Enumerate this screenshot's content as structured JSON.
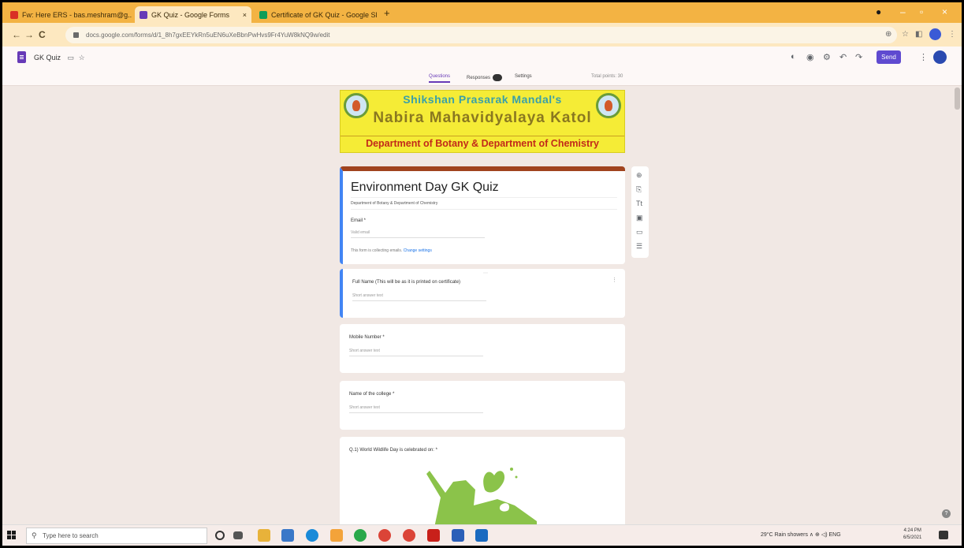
{
  "browser": {
    "tabs": [
      {
        "label": "Fw: Here ERS - bas.meshram@g...",
        "active": false,
        "favicon_color": "#d93025"
      },
      {
        "label": "GK Quiz - Google Forms",
        "active": true,
        "favicon_color": "#673ab7"
      },
      {
        "label": "Certificate of GK Quiz - Google Sli...",
        "active": false,
        "favicon_color": "#0f9d58"
      }
    ],
    "new_tab": "+",
    "url": "docs.google.com/forms/d/1_8h7gxEEYkRn5uEN6uXeBbnPwHvs9Fr4YuW8kNQ9w/edit",
    "back": "←",
    "forward": "→",
    "reload": "C"
  },
  "forms_header": {
    "doc_title": "GK Quiz",
    "send_label": "Send",
    "tabs": {
      "questions": "Questions",
      "responses": "Responses",
      "settings": "Settings"
    },
    "total_points": "Total points: 30"
  },
  "banner": {
    "line1": "Shikshan Prasarak Mandal's",
    "line2": "Nabira Mahavidyalaya Katol",
    "line3": "Department of Botany & Department of Chemistry"
  },
  "form": {
    "title": "Environment Day GK Quiz",
    "description": "Department of Botany & Department of Chemistry",
    "email_label": "Email *",
    "email_placeholder": "Valid email",
    "email_note": "This form is collecting emails.",
    "email_note_link": "Change settings"
  },
  "questions": [
    {
      "label": "Full Name (This will be as it is printed on certificate)",
      "placeholder": "Short answer text"
    },
    {
      "label": "Mobile Number *",
      "placeholder": "Short answer text"
    },
    {
      "label": "Name of the college *",
      "placeholder": "Short answer text"
    },
    {
      "label": "Q.1) World Wildlife Day is celebrated on: *",
      "placeholder": ""
    }
  ],
  "taskbar": {
    "search_placeholder": "Type here to search",
    "tray_text": "29°C Rain showers ∧ ⊕ ◁) ENG",
    "time": "4:24 PM",
    "date": "6/5/2021"
  },
  "colors": {
    "accent": "#673ab7",
    "title_border": "#a0431e",
    "banner_bg": "#f5ec36",
    "illustration": "#8bc34a"
  }
}
